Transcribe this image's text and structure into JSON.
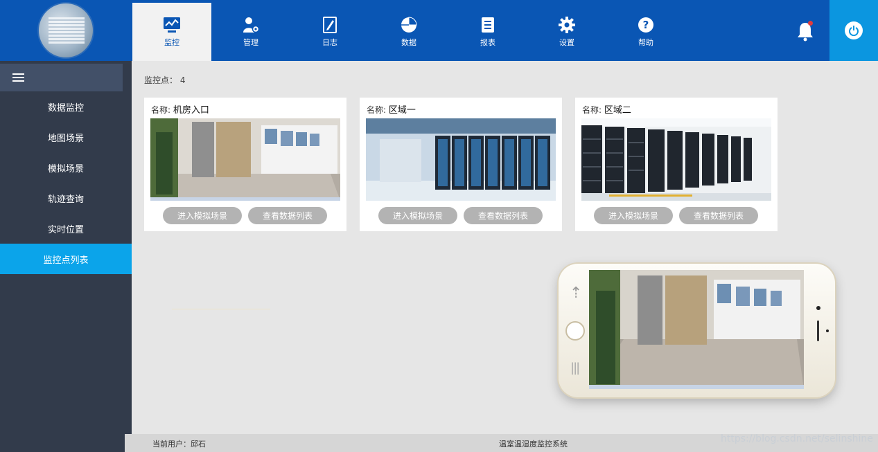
{
  "nav": {
    "items": [
      {
        "label": "监控",
        "icon": "monitor-chart-icon"
      },
      {
        "label": "管理",
        "icon": "user-gear-icon"
      },
      {
        "label": "日志",
        "icon": "notebook-icon"
      },
      {
        "label": "数据",
        "icon": "pie-chart-icon"
      },
      {
        "label": "报表",
        "icon": "document-list-icon"
      },
      {
        "label": "设置",
        "icon": "gear-icon"
      },
      {
        "label": "帮助",
        "icon": "help-icon"
      }
    ],
    "active_index": 0,
    "notification_icon": "bell-icon",
    "power_icon": "power-icon"
  },
  "sidebar": {
    "items": [
      {
        "label": "数据监控"
      },
      {
        "label": "地图场景"
      },
      {
        "label": "模拟场景"
      },
      {
        "label": "轨迹查询"
      },
      {
        "label": "实时位置"
      },
      {
        "label": "监控点列表"
      }
    ],
    "active_index": 5
  },
  "main": {
    "count_label": "监控点：",
    "count_value": "4",
    "cards": [
      {
        "name_label": "名称:",
        "name": "机房入口",
        "btn_scene": "进入模拟场景",
        "btn_data": "查看数据列表"
      },
      {
        "name_label": "名称:",
        "name": "区域一",
        "btn_scene": "进入模拟场景",
        "btn_data": "查看数据列表"
      },
      {
        "name_label": "名称:",
        "name": "区域二",
        "btn_scene": "进入模拟场景",
        "btn_data": "查看数据列表"
      }
    ]
  },
  "footer": {
    "user_label": "当前用户：",
    "user_name": "邱石",
    "system_name": "温室温湿度监控系统"
  },
  "watermark": "https://blog.csdn.net/selinshine",
  "colors": {
    "topbar": "#0a56b4",
    "sidebar": "#323b4b",
    "active": "#0ba4ea",
    "alert": "#e23b3b"
  }
}
